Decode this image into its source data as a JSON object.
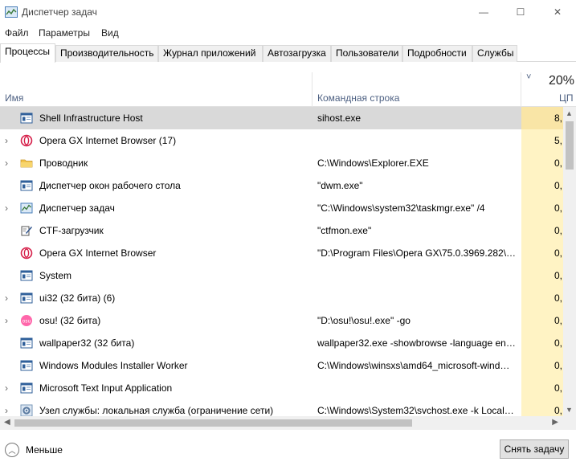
{
  "window": {
    "title": "Диспетчер задач",
    "minimize_glyph": "—",
    "maximize_glyph": "☐",
    "close_glyph": "✕"
  },
  "menu": [
    "Файл",
    "Параметры",
    "Вид"
  ],
  "tabs": [
    {
      "label": "Процессы",
      "active": true
    },
    {
      "label": "Производительность",
      "active": false
    },
    {
      "label": "Журнал приложений",
      "active": false
    },
    {
      "label": "Автозагрузка",
      "active": false
    },
    {
      "label": "Пользователи",
      "active": false
    },
    {
      "label": "Подробности",
      "active": false
    },
    {
      "label": "Службы",
      "active": false
    }
  ],
  "columns": {
    "name": "Имя",
    "command": "Командная строка",
    "cpu_percent": "20%",
    "cpu_label": "ЦП",
    "sort_glyph": "˅"
  },
  "rows": [
    {
      "name": "Shell Infrastructure Host",
      "cmd": "sihost.exe",
      "cpu": "8,",
      "expandable": false,
      "icon": "window-icon",
      "selected": true
    },
    {
      "name": "Opera GX Internet Browser (17)",
      "cmd": "",
      "cpu": "5,",
      "expandable": true,
      "icon": "opera-icon",
      "selected": false
    },
    {
      "name": "Проводник",
      "cmd": "C:\\Windows\\Explorer.EXE",
      "cpu": "0,",
      "expandable": true,
      "icon": "folder-icon",
      "selected": false
    },
    {
      "name": "Диспетчер окон рабочего стола",
      "cmd": "\"dwm.exe\"",
      "cpu": "0,",
      "expandable": false,
      "icon": "window-icon",
      "selected": false
    },
    {
      "name": "Диспетчер задач",
      "cmd": "\"C:\\Windows\\system32\\taskmgr.exe\" /4",
      "cpu": "0,",
      "expandable": true,
      "icon": "taskmgr-icon",
      "selected": false
    },
    {
      "name": "CTF-загрузчик",
      "cmd": "\"ctfmon.exe\"",
      "cpu": "0,",
      "expandable": false,
      "icon": "pen-icon",
      "selected": false
    },
    {
      "name": "Opera GX Internet Browser",
      "cmd": "\"D:\\Program Files\\Opera GX\\75.0.3969.282\\o…",
      "cpu": "0,",
      "expandable": false,
      "icon": "opera-icon",
      "selected": false
    },
    {
      "name": "System",
      "cmd": "",
      "cpu": "0,",
      "expandable": false,
      "icon": "window-icon",
      "selected": false
    },
    {
      "name": "ui32 (32 бита) (6)",
      "cmd": "",
      "cpu": "0,",
      "expandable": true,
      "icon": "window-icon",
      "selected": false
    },
    {
      "name": "osu! (32 бита)",
      "cmd": "\"D:\\osu!\\osu!.exe\" -go",
      "cpu": "0,",
      "expandable": true,
      "icon": "osu-icon",
      "selected": false
    },
    {
      "name": "wallpaper32 (32 бита)",
      "cmd": "wallpaper32.exe -showbrowse -language eng…",
      "cpu": "0,",
      "expandable": false,
      "icon": "window-icon",
      "selected": false
    },
    {
      "name": "Windows Modules Installer Worker",
      "cmd": "C:\\Windows\\winsxs\\amd64_microsoft-wind…",
      "cpu": "0,",
      "expandable": false,
      "icon": "window-icon",
      "selected": false
    },
    {
      "name": "Microsoft Text Input Application",
      "cmd": "",
      "cpu": "0,",
      "expandable": true,
      "icon": "window-icon",
      "selected": false
    },
    {
      "name": "Узел службы: локальная служба (ограничение сети)",
      "cmd": "C:\\Windows\\System32\\svchost.exe -k LocalS…",
      "cpu": "0,",
      "expandable": true,
      "icon": "gear-icon",
      "selected": false
    }
  ],
  "footer": {
    "less_label": "Меньше",
    "end_task_label": "Снять задачу"
  },
  "colors": {
    "selected_row": "#d9d9d9",
    "cpu_column": "#fff3c4",
    "header_text": "#4d6082"
  }
}
